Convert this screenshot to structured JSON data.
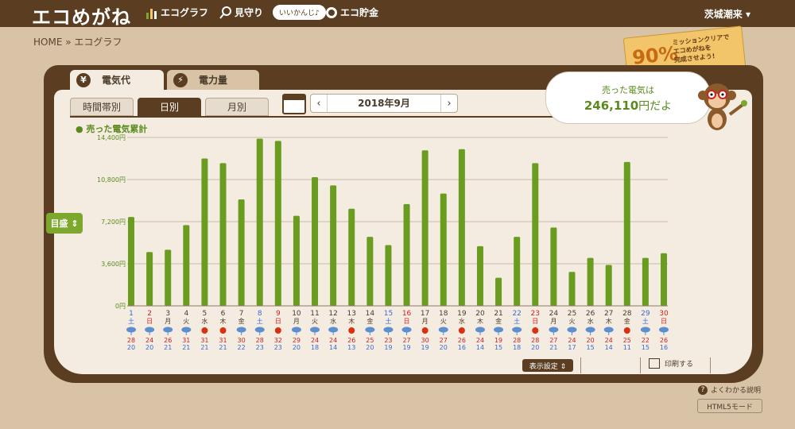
{
  "header": {
    "logo": "エコめがね",
    "nav": [
      {
        "label": "エコグラフ",
        "icon": "bar-graph-icon"
      },
      {
        "label": "見守り",
        "icon": "magnifier-icon"
      },
      {
        "label": "エコ貯金",
        "icon": "coin-icon"
      }
    ],
    "bubble": "いいかんじ♪",
    "user": "茨城潮来 ▾"
  },
  "breadcrumb": "HOME » エコグラフ",
  "mission": {
    "percent": "90%",
    "message": "ミッションクリアで\nエコめがねを\n完成させよう!"
  },
  "tabs": {
    "cost": "電気代",
    "power": "電力量",
    "cost_icon": "¥",
    "power_icon": "⚡"
  },
  "subtabs": [
    "時間帯別",
    "日別",
    "月別"
  ],
  "active_subtab": 1,
  "month": {
    "label": "2018年9月",
    "prev": "‹",
    "next": "›"
  },
  "sold": {
    "line1": "売った電気は",
    "amount": "246,110",
    "unit": "円だよ"
  },
  "legend": "● 売った電気累計",
  "goal_button": "目盛 ⇕",
  "buttons": {
    "display": "表示設定 ⇕",
    "print": "印刷する",
    "help": "よくわかる説明",
    "html5": "HTML5モード"
  },
  "chart_data": {
    "type": "bar",
    "ylim": [
      0,
      14400
    ],
    "yticks": [
      "0円",
      "3,600円",
      "7,200円",
      "10,800円",
      "14,400円"
    ],
    "bar_color": "#6a9d1f",
    "days": [
      "1",
      "2",
      "3",
      "4",
      "5",
      "6",
      "7",
      "8",
      "9",
      "10",
      "11",
      "12",
      "13",
      "14",
      "15",
      "16",
      "17",
      "18",
      "19",
      "20",
      "21",
      "22",
      "23",
      "24",
      "25",
      "26",
      "27",
      "28",
      "29",
      "30"
    ],
    "weekdays": [
      "土",
      "日",
      "月",
      "火",
      "水",
      "木",
      "金",
      "土",
      "日",
      "月",
      "火",
      "水",
      "木",
      "金",
      "土",
      "日",
      "月",
      "火",
      "水",
      "木",
      "金",
      "土",
      "日",
      "月",
      "火",
      "水",
      "木",
      "金",
      "土",
      "日"
    ],
    "values": [
      7600,
      4600,
      4800,
      6900,
      12600,
      12200,
      9100,
      14300,
      14100,
      7700,
      11000,
      10300,
      8300,
      5900,
      5200,
      8700,
      13300,
      9600,
      13400,
      5100,
      2400,
      5900,
      12200,
      6700,
      2900,
      4100,
      3500,
      12300,
      4100,
      4500
    ],
    "weather": [
      "rain",
      "rain",
      "rain",
      "rain",
      "sun",
      "sun",
      "rain",
      "rain",
      "sun",
      "rain",
      "rain",
      "rain",
      "sun",
      "rain",
      "rain",
      "rain",
      "sun",
      "rain",
      "sun",
      "rain",
      "rain",
      "rain",
      "sun",
      "rain",
      "rain",
      "rain",
      "rain",
      "sun",
      "rain",
      "rain"
    ],
    "high": [
      28,
      24,
      26,
      31,
      31,
      31,
      30,
      28,
      32,
      29,
      24,
      24,
      26,
      25,
      23,
      27,
      30,
      27,
      26,
      24,
      19,
      28,
      28,
      27,
      24,
      20,
      24,
      25,
      22,
      26
    ],
    "low": [
      20,
      20,
      21,
      21,
      21,
      21,
      22,
      23,
      23,
      20,
      18,
      14,
      13,
      20,
      19,
      19,
      19,
      20,
      16,
      14,
      15,
      18,
      20,
      21,
      17,
      15,
      14,
      11,
      15,
      16
    ]
  }
}
